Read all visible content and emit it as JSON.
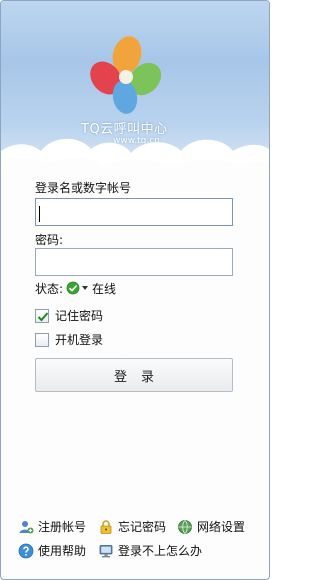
{
  "header": {
    "brand": "TQ云呼叫中心",
    "brand_url": "www.tq.cn"
  },
  "form": {
    "username_label": "登录名或数字帐号",
    "username_value": "",
    "password_label": "密码:",
    "password_value": "",
    "status_label": "状态:",
    "status_value": "在线",
    "remember_password_label": "记住密码",
    "remember_password_checked": true,
    "auto_start_label": "开机登录",
    "auto_start_checked": false,
    "login_button": "登录"
  },
  "footer": {
    "register": "注册帐号",
    "forgot_password": "忘记密码",
    "network_settings": "网络设置",
    "help": "使用帮助",
    "cannot_login": "登录不上怎么办"
  },
  "colors": {
    "header_sky": "#a7c6e8",
    "status_online": "#3aa534"
  }
}
